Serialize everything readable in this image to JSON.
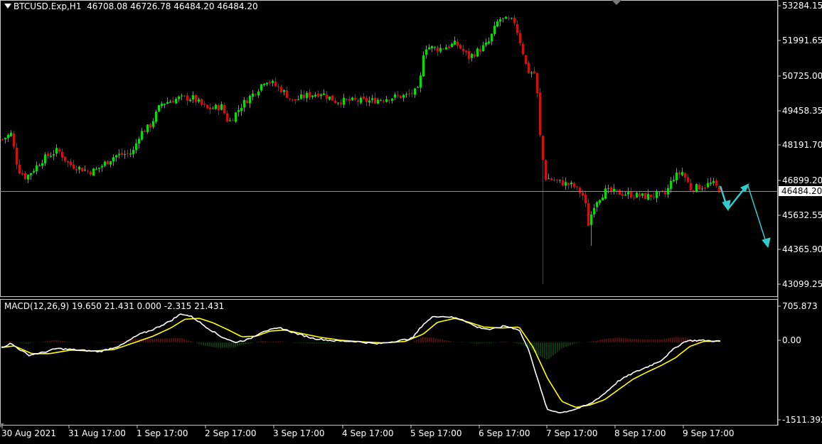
{
  "header": {
    "symbol_timeframe": "BTCUSD.Exp,H1",
    "ohlc": "46708.08 46726.78 46484.20 46484.20"
  },
  "price_axis": {
    "ticks": [
      "53284.15",
      "51991.65",
      "50725.00",
      "49458.35",
      "48191.70",
      "46899.20",
      "45632.55",
      "44365.90",
      "43099.25"
    ],
    "current_price_label": "46484.20"
  },
  "macd": {
    "title": "MACD(12,26,9) 19.650 21.431 0.000 -2.315 21.431",
    "ticks": [
      "705.873",
      "0.00",
      "-1511.392"
    ]
  },
  "time_axis": {
    "labels": [
      "30 Aug 2021",
      "31 Aug 17:00",
      "1 Sep 17:00",
      "2 Sep 17:00",
      "3 Sep 17:00",
      "4 Sep 17:00",
      "5 Sep 17:00",
      "6 Sep 17:00",
      "7 Sep 17:00",
      "8 Sep 17:00",
      "9 Sep 17:00"
    ]
  },
  "colors": {
    "background": "#000000",
    "bull_candle": "#00e000",
    "bear_candle": "#d01010",
    "hist_positive": "#a01818",
    "hist_negative": "#1e6a1e",
    "macd_line": "#ffffff",
    "signal_line": "#ffff00",
    "forecast_arrow": "#33cccc",
    "grid_border": "#ffffff"
  },
  "chart_data": [
    {
      "type": "line",
      "title": "BTCUSD.Exp,H1",
      "ylim": [
        43099.25,
        53284.15
      ],
      "x": [
        "30 Aug 2021",
        "31 Aug 17:00",
        "1 Sep 17:00",
        "2 Sep 17:00",
        "3 Sep 17:00",
        "4 Sep 17:00",
        "5 Sep 17:00",
        "6 Sep 17:00",
        "7 Sep 17:00",
        "8 Sep 17:00",
        "9 Sep 17:00"
      ],
      "series": [
        {
          "values": [
            47400,
            47000,
            48700,
            49500,
            49600,
            49500,
            51600,
            52900,
            46900,
            46100,
            46480
          ]
        }
      ],
      "current_price": 46484.2,
      "forecast_path": [
        46484.2,
        45900,
        46800,
        44500
      ]
    },
    {
      "type": "line",
      "title": "MACD(12,26,9)",
      "ylim": [
        -1511.392,
        705.873
      ],
      "x": [
        "30 Aug 2021",
        "31 Aug 17:00",
        "1 Sep 17:00",
        "2 Sep 17:00",
        "3 Sep 17:00",
        "4 Sep 17:00",
        "5 Sep 17:00",
        "6 Sep 17:00",
        "7 Sep 17:00",
        "8 Sep 17:00",
        "9 Sep 17:00"
      ],
      "series": [
        {
          "values": [
            -40,
            -120,
            200,
            380,
            90,
            100,
            280,
            500,
            -1300,
            -600,
            30
          ]
        },
        {
          "values": [
            -10,
            -110,
            150,
            300,
            140,
            60,
            250,
            420,
            -1100,
            -650,
            25
          ]
        }
      ],
      "values_shown": [
        19.65,
        21.431,
        0.0,
        -2.315,
        21.431
      ]
    }
  ]
}
